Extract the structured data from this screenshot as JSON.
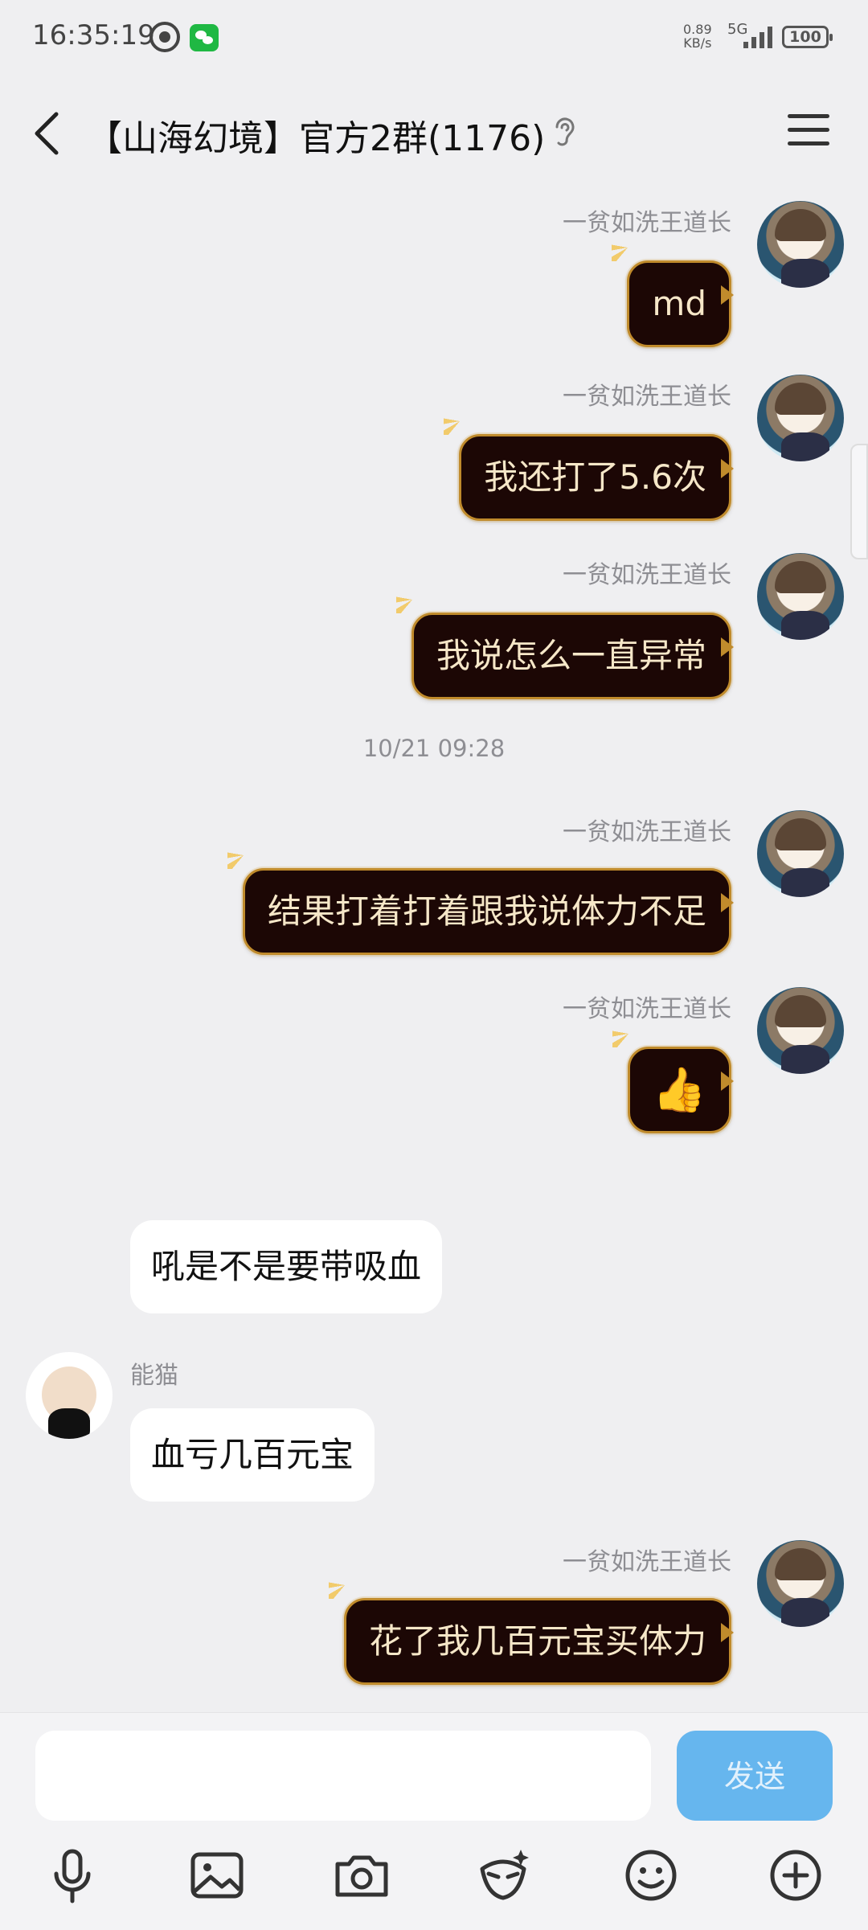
{
  "status_bar": {
    "time": "16:35:19",
    "net_speed": "0.89",
    "net_unit": "KB/s",
    "network": "5G",
    "battery": "100"
  },
  "header": {
    "title": "【山海幻境】官方2群(1176)"
  },
  "messages": [
    {
      "side": "right",
      "sender": "一贫如洗王道长",
      "text": "md"
    },
    {
      "side": "right",
      "sender": "一贫如洗王道长",
      "text": "我还打了5.6次"
    },
    {
      "side": "right",
      "sender": "一贫如洗王道长",
      "text": "我说怎么一直异常"
    },
    {
      "type": "timestamp",
      "text": "10/21 09:28"
    },
    {
      "side": "right",
      "sender": "一贫如洗王道长",
      "text": "结果打着打着跟我说体力不足"
    },
    {
      "side": "right",
      "sender": "一贫如洗王道长",
      "text": "👍"
    },
    {
      "side": "left",
      "sender": "",
      "text": "吼是不是要带吸血"
    },
    {
      "side": "left",
      "sender": "能猫",
      "text": "血亏几百元宝"
    },
    {
      "side": "right",
      "sender": "一贫如洗王道长",
      "text": "花了我几百元宝买体力"
    }
  ],
  "input": {
    "placeholder": "",
    "send_label": "发送"
  },
  "toolbar": [
    "microphone-icon",
    "image-icon",
    "camera-icon",
    "magic-icon",
    "emoji-icon",
    "plus-icon"
  ],
  "colors": {
    "vip_bubble": "#1c0705",
    "vip_border": "#c08b2c",
    "send_button": "#66b6ee",
    "background": "#efeff1"
  }
}
